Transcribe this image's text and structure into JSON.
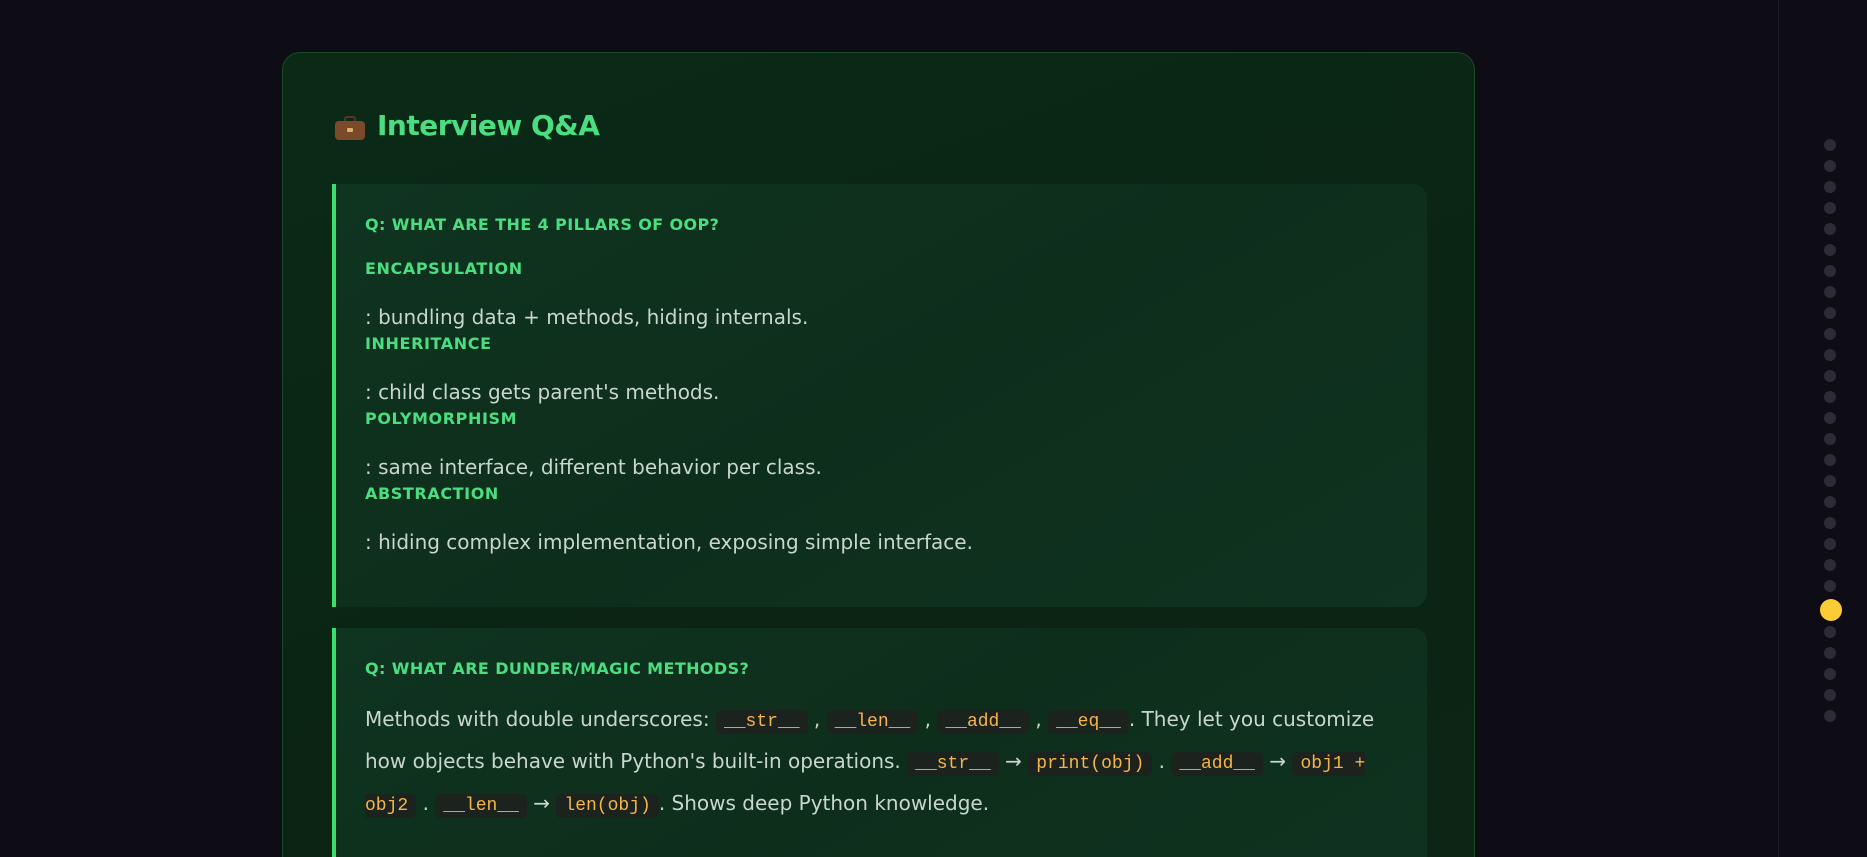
{
  "section": {
    "title": "Interview Q&A",
    "icon": "briefcase-icon"
  },
  "qa": [
    {
      "question": "Q: What are the 4 pillars of OOP?",
      "items": [
        {
          "term": "Encapsulation",
          "desc": ": bundling data + methods, hiding internals."
        },
        {
          "term": "Inheritance",
          "desc": ": child class gets parent's methods."
        },
        {
          "term": "Polymorphism",
          "desc": ": same interface, different behavior per class."
        },
        {
          "term": "Abstraction",
          "desc": ": hiding complex implementation, exposing simple interface."
        }
      ]
    },
    {
      "question": "Q: What are dunder/magic methods?",
      "text": {
        "intro": "Methods with double underscores:",
        "c1": "__str__",
        "c2": "__len__",
        "c3": "__add__",
        "c4": "__eq__",
        "mid": ". They let you customize how objects behave with Python's built-in operations.",
        "c5": "__str__",
        "arrow1": "→",
        "c6": "print(obj)",
        "c7": "__add__",
        "arrow2": "→",
        "c8": "obj1 + obj2",
        "c9": "__len__",
        "arrow3": "→",
        "c10": "len(obj)",
        "outro": ". Shows deep Python knowledge."
      }
    }
  ],
  "progress_nav": {
    "total_dots": 28,
    "active_index": 22,
    "active_color": "#fbcc33",
    "dot_color": "#2c2b38"
  },
  "colors": {
    "accent_green": "#4ade80",
    "code_text": "#f5b54a",
    "background": "#0e0c14"
  }
}
